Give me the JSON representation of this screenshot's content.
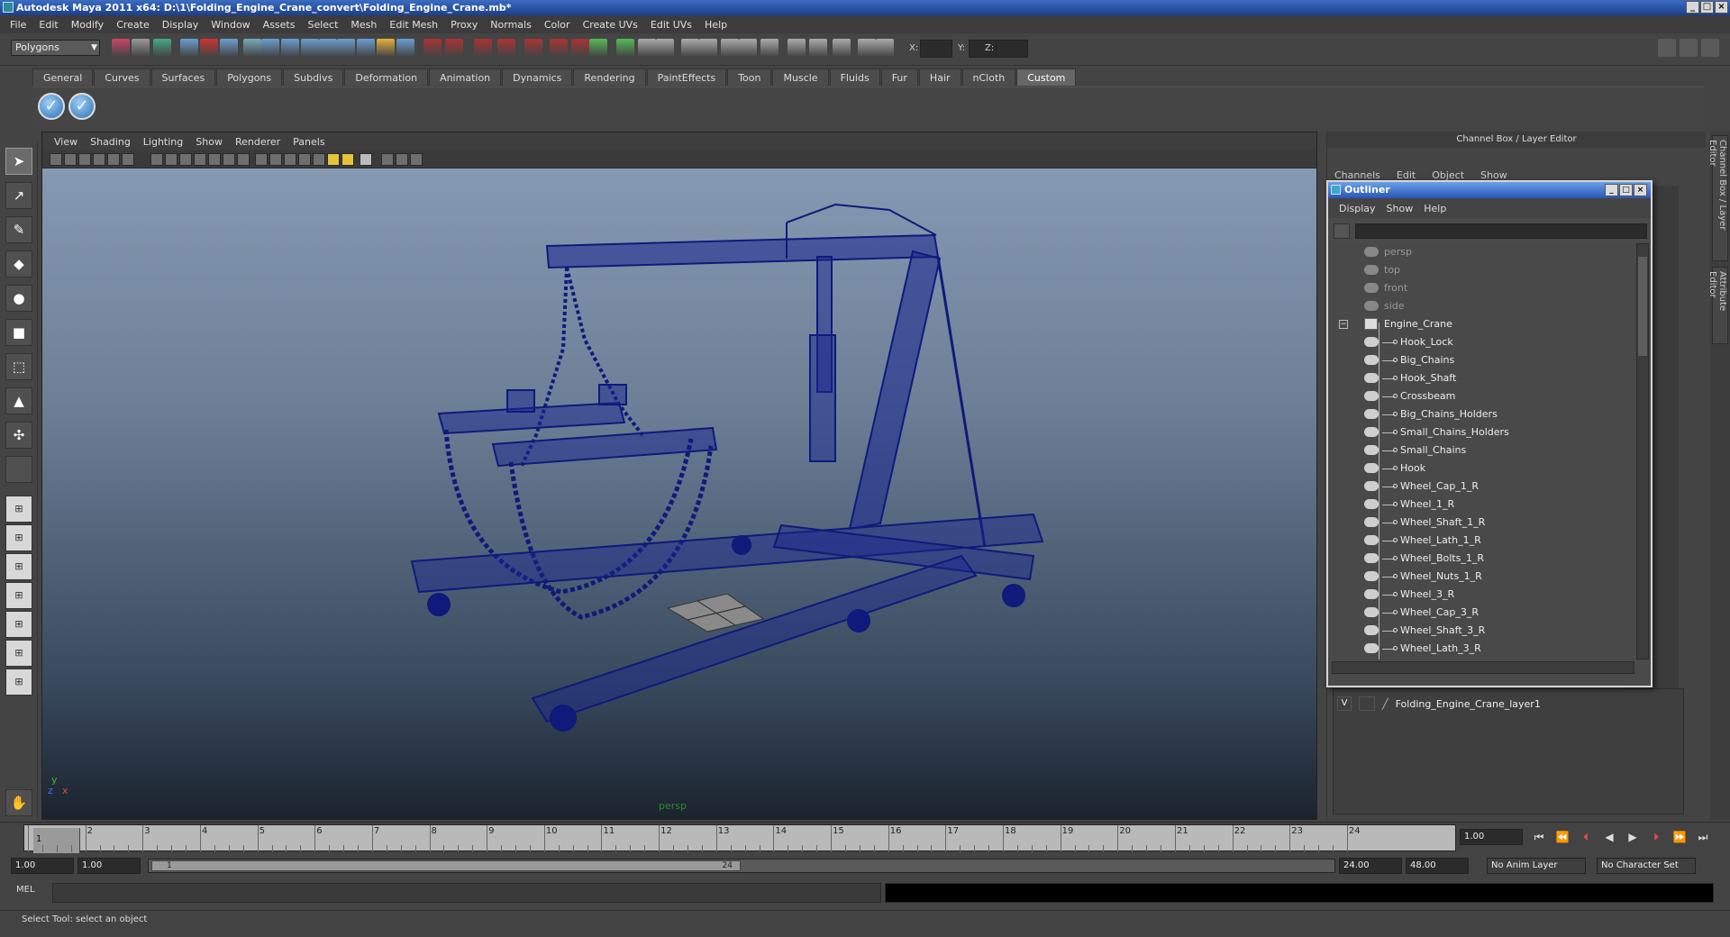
{
  "window": {
    "title": "Autodesk Maya 2011 x64: D:\\1\\Folding_Engine_Crane_convert\\Folding_Engine_Crane.mb*",
    "buttons": [
      "_",
      "□",
      "×"
    ]
  },
  "menubar": [
    "File",
    "Edit",
    "Modify",
    "Create",
    "Display",
    "Window",
    "Assets",
    "Select",
    "Mesh",
    "Edit Mesh",
    "Proxy",
    "Normals",
    "Color",
    "Create UVs",
    "Edit UVs",
    "Help"
  ],
  "statusline": {
    "mode": "Polygons",
    "coord_labels": [
      "X:",
      "Y:",
      "Z:"
    ]
  },
  "shelf": {
    "tabs": [
      "General",
      "Curves",
      "Surfaces",
      "Polygons",
      "Subdivs",
      "Deformation",
      "Animation",
      "Dynamics",
      "Rendering",
      "PaintEffects",
      "Toon",
      "Muscle",
      "Fluids",
      "Fur",
      "Hair",
      "nCloth",
      "Custom"
    ],
    "active_tab": "Custom",
    "buttons": [
      {
        "icon": "check-icon"
      },
      {
        "icon": "check-icon"
      }
    ]
  },
  "toolbox": {
    "tools": [
      {
        "name": "select-tool",
        "glyph": "➤"
      },
      {
        "name": "lasso-tool",
        "glyph": "↗"
      },
      {
        "name": "paint-select-tool",
        "glyph": "✎"
      },
      {
        "name": "move-tool",
        "glyph": "◆"
      },
      {
        "name": "rotate-tool",
        "glyph": "●"
      },
      {
        "name": "scale-tool",
        "glyph": "■"
      },
      {
        "name": "manipulator-tool",
        "glyph": "⬚"
      },
      {
        "name": "soft-mod-tool",
        "glyph": "▲"
      },
      {
        "name": "show-manipulator-tool",
        "glyph": "✣"
      },
      {
        "name": "last-tool",
        "glyph": ""
      }
    ],
    "layouts": [
      "single-pane",
      "four-pane",
      "outliner-persp",
      "graph-persp",
      "persp-graph-hypershade",
      "hypershade-persp",
      "graph-persp-2"
    ]
  },
  "viewport": {
    "menu": [
      "View",
      "Shading",
      "Lighting",
      "Show",
      "Renderer",
      "Panels"
    ],
    "camera": "persp",
    "axis": {
      "y": "y",
      "x": "x",
      "z": "z"
    }
  },
  "channelbox": {
    "title": "Channel Box / Layer Editor",
    "menu": [
      "Channels",
      "Edit",
      "Object",
      "Show"
    ],
    "layer": {
      "visible": "V",
      "name": "Folding_Engine_Crane_layer1"
    }
  },
  "sidetabs": [
    "Channel Box / Layer Editor",
    "Attribute Editor"
  ],
  "outliner": {
    "title": "Outliner",
    "menu": [
      "Display",
      "Show",
      "Help"
    ],
    "cameras": [
      "persp",
      "top",
      "front",
      "side"
    ],
    "group": "Engine_Crane",
    "children": [
      "Hook_Lock",
      "Big_Chains",
      "Hook_Shaft",
      "Crossbeam",
      "Big_Chains_Holders",
      "Small_Chains_Holders",
      "Small_Chains",
      "Hook",
      "Wheel_Cap_1_R",
      "Wheel_1_R",
      "Wheel_Shaft_1_R",
      "Wheel_Lath_1_R",
      "Wheel_Bolts_1_R",
      "Wheel_Nuts_1_R",
      "Wheel_3_R",
      "Wheel_Cap_3_R",
      "Wheel_Shaft_3_R",
      "Wheel_Lath_3_R"
    ]
  },
  "timeslider": {
    "ticks": [
      "1",
      "2",
      "3",
      "4",
      "5",
      "6",
      "7",
      "8",
      "9",
      "10",
      "11",
      "12",
      "13",
      "14",
      "15",
      "16",
      "17",
      "18",
      "19",
      "20",
      "21",
      "22",
      "23",
      "24"
    ],
    "current_frame": "1",
    "current_time": "1.00"
  },
  "range": {
    "start": "1.00",
    "playback_start": "1.00",
    "bar_start": "1",
    "bar_end": "24",
    "playback_end": "24.00",
    "end": "48.00",
    "anim_layer": "No Anim Layer",
    "character_set": "No Character Set"
  },
  "cmdline": {
    "label": "MEL"
  },
  "help": {
    "text": "Select Tool: select an object"
  }
}
